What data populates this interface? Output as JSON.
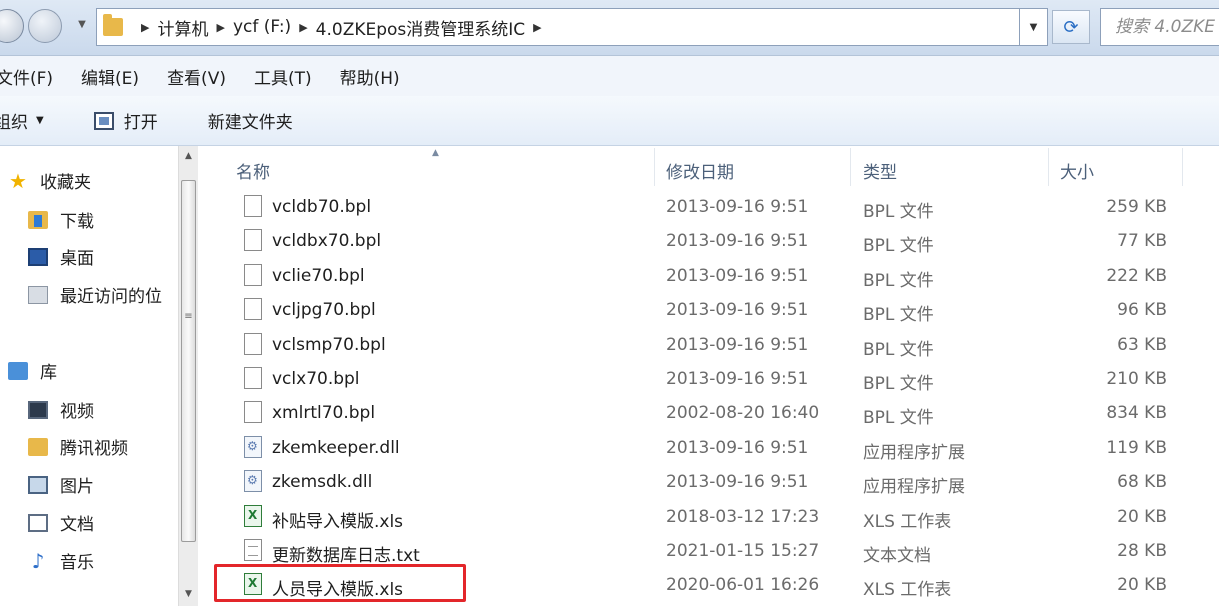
{
  "address_bar": {
    "crumbs": [
      "计算机",
      "ycf (F:)",
      "4.0ZKEpos消费管理系统IC"
    ],
    "search_placeholder": "搜索 4.0ZKE"
  },
  "menu": [
    "文件(F)",
    "编辑(E)",
    "查看(V)",
    "工具(T)",
    "帮助(H)"
  ],
  "toolbar": {
    "organize_label": "组织",
    "open_label": "打开",
    "new_folder_label": "新建文件夹"
  },
  "nav_pane": {
    "favorites": "收藏夹",
    "downloads": "下载",
    "desktop": "桌面",
    "recent": "最近访问的位",
    "libraries": "库",
    "videos": "视频",
    "tencent_video": "腾讯视频",
    "pictures": "图片",
    "documents": "文档",
    "music": "音乐"
  },
  "columns": [
    "名称",
    "修改日期",
    "类型",
    "大小"
  ],
  "files": [
    {
      "name": "vcldb70.bpl",
      "date": "2013-09-16 9:51",
      "type": "BPL 文件",
      "size": "259 KB",
      "icon": "file"
    },
    {
      "name": "vcldbx70.bpl",
      "date": "2013-09-16 9:51",
      "type": "BPL 文件",
      "size": "77 KB",
      "icon": "file"
    },
    {
      "name": "vclie70.bpl",
      "date": "2013-09-16 9:51",
      "type": "BPL 文件",
      "size": "222 KB",
      "icon": "file"
    },
    {
      "name": "vcljpg70.bpl",
      "date": "2013-09-16 9:51",
      "type": "BPL 文件",
      "size": "96 KB",
      "icon": "file"
    },
    {
      "name": "vclsmp70.bpl",
      "date": "2013-09-16 9:51",
      "type": "BPL 文件",
      "size": "63 KB",
      "icon": "file"
    },
    {
      "name": "vclx70.bpl",
      "date": "2013-09-16 9:51",
      "type": "BPL 文件",
      "size": "210 KB",
      "icon": "file"
    },
    {
      "name": "xmlrtl70.bpl",
      "date": "2002-08-20 16:40",
      "type": "BPL 文件",
      "size": "834 KB",
      "icon": "file"
    },
    {
      "name": "zkemkeeper.dll",
      "date": "2013-09-16 9:51",
      "type": "应用程序扩展",
      "size": "119 KB",
      "icon": "dll"
    },
    {
      "name": "zkemsdk.dll",
      "date": "2013-09-16 9:51",
      "type": "应用程序扩展",
      "size": "68 KB",
      "icon": "dll"
    },
    {
      "name": "补贴导入模版.xls",
      "date": "2018-03-12 17:23",
      "type": "XLS 工作表",
      "size": "20 KB",
      "icon": "xls"
    },
    {
      "name": "更新数据库日志.txt",
      "date": "2021-01-15 15:27",
      "type": "文本文档",
      "size": "28 KB",
      "icon": "txt"
    },
    {
      "name": "人员导入模版.xls",
      "date": "2020-06-01 16:26",
      "type": "XLS 工作表",
      "size": "20 KB",
      "icon": "xls"
    }
  ]
}
